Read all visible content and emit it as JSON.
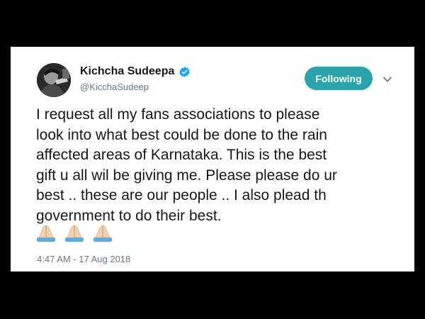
{
  "tweet": {
    "author_name": "Kichcha Sudeepa",
    "author_handle": "@KicchaSudeep",
    "follow_button_label": "Following",
    "text_lines": [
      "I request all my fans associations to please",
      "look into what best could be done to the rain",
      "affected areas of Karnataka. This is the best",
      "gift u all wil be giving me. Please please do ur",
      "best .. these are our people .. I also plead th",
      "government to do their best."
    ],
    "emojis": [
      "folded-hands",
      "folded-hands",
      "folded-hands"
    ],
    "timestamp": "4:47 AM - 17 Aug 2018",
    "verified": true
  },
  "colors": {
    "background": "#000000",
    "card": "#ffffff",
    "follow_button": "#2aa3ab",
    "verified_badge": "#1da1f2",
    "text_primary": "#14171a",
    "text_secondary": "#657786"
  }
}
